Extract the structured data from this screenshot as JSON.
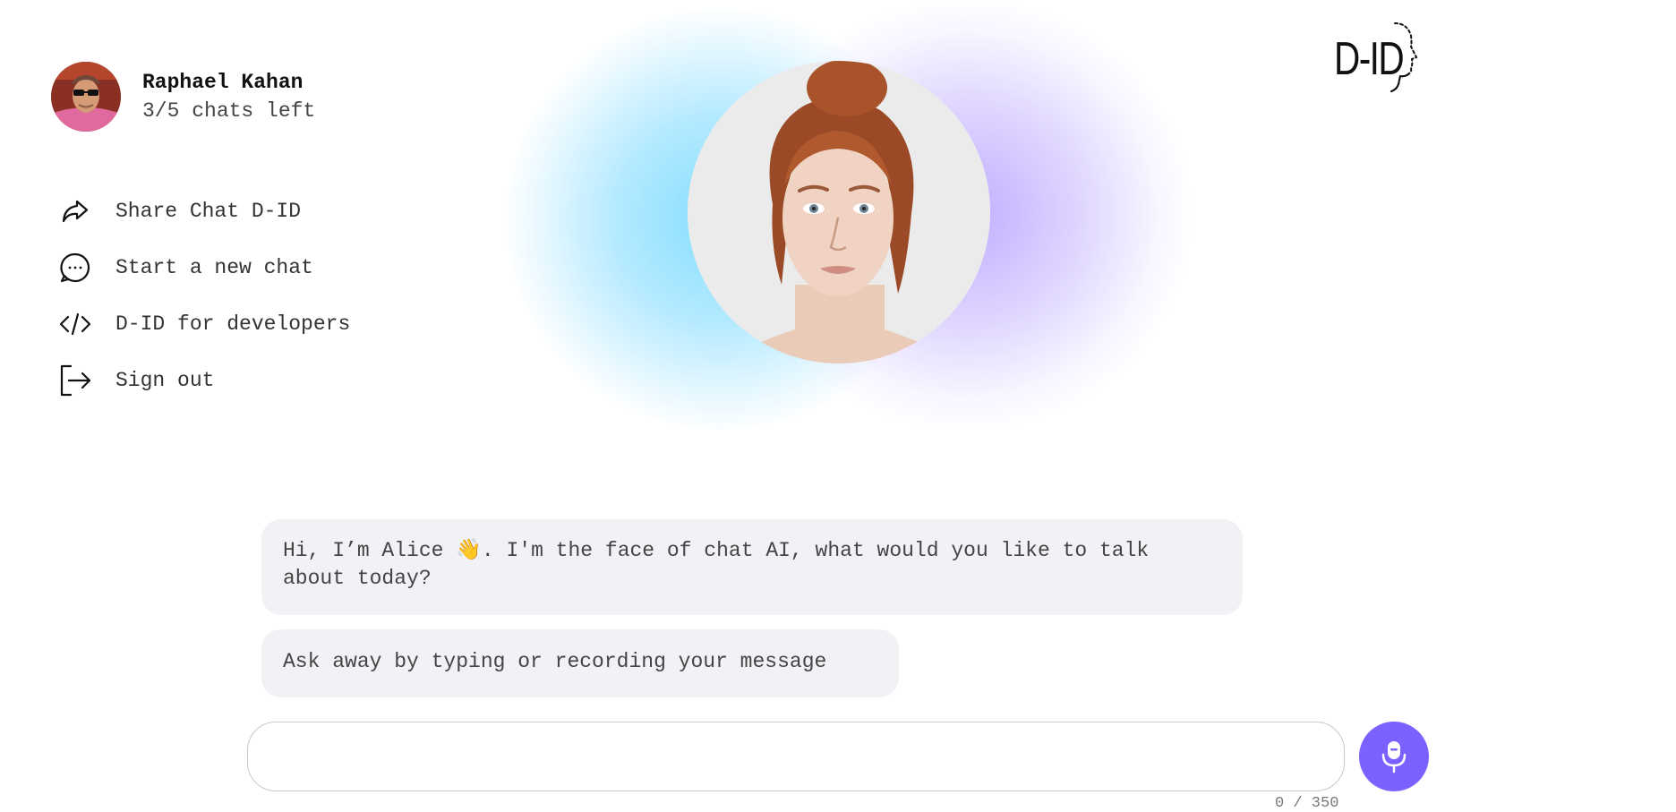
{
  "user": {
    "name": "Raphael Kahan",
    "quota": "3/5 chats left"
  },
  "menu": [
    {
      "label": "Share Chat D-ID",
      "icon": "share-arrow-icon"
    },
    {
      "label": "Start a new chat",
      "icon": "chat-bubble-icon"
    },
    {
      "label": "D-ID for developers",
      "icon": "code-icon"
    },
    {
      "label": "Sign out",
      "icon": "sign-out-icon"
    }
  ],
  "brand": {
    "logo_text": "D-ID",
    "accent": "#7b61ff"
  },
  "chat": {
    "messages": [
      "Hi, I’m Alice 👋. I'm the face of chat AI, what would you like to talk about today?",
      "Ask away by typing or recording your message"
    ],
    "input_value": "",
    "counter": "0 / 350"
  },
  "colors": {
    "bubble_bg": "#f1f2f5",
    "glow_blue": "#7ddcff",
    "glow_purple": "#b9a5ff",
    "mic_button": "#7b61ff"
  }
}
